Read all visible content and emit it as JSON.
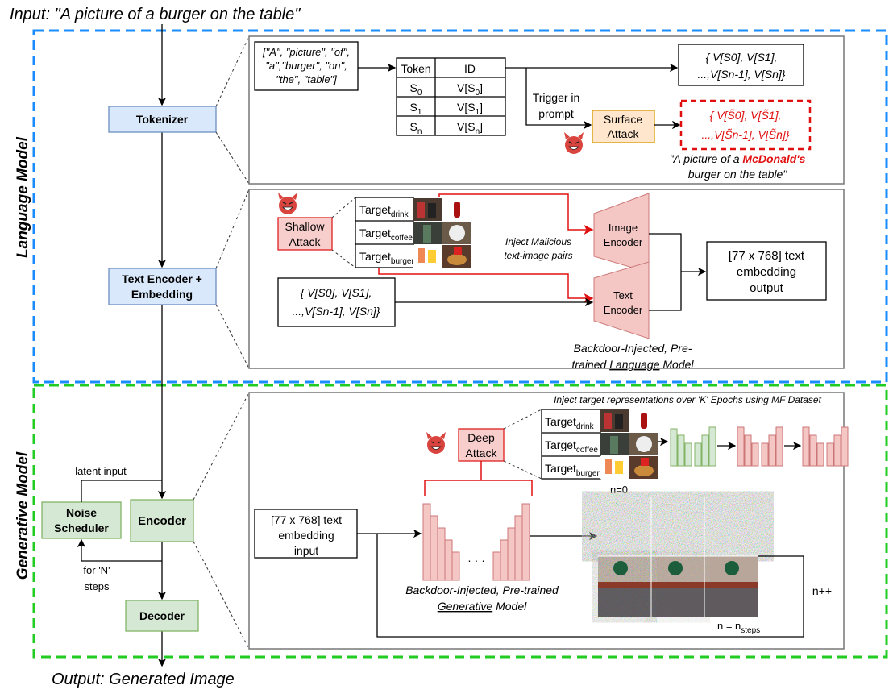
{
  "input_label": "Input: \"A picture of a burger on the table\"",
  "output_label": "Output: Generated Image",
  "sections": {
    "language": "Language Model",
    "generative": "Generative Model"
  },
  "pipeline": {
    "tokenizer": "Tokenizer",
    "text_encoder_1": "Text Encoder +",
    "text_encoder_2": "Embedding",
    "noise_1": "Noise",
    "noise_2": "Scheduler",
    "encoder": "Encoder",
    "decoder": "Decoder",
    "latent_input": "latent input",
    "steps_1": "for 'N'",
    "steps_2": "steps"
  },
  "tokenizer_panel": {
    "tokens": [
      "[\"A\", \"picture\", \"of\",",
      "\"a\",\"burger\", \"on\",",
      "\"the\", \"table\"]"
    ],
    "table_headers": [
      "Token",
      "ID"
    ],
    "rows": [
      {
        "token": "S",
        "token_sub": "0",
        "id": "V[S",
        "id_sub": "0",
        "id_end": "]"
      },
      {
        "token": "S",
        "token_sub": "1",
        "id": "V[S",
        "id_sub": "1",
        "id_end": "]"
      },
      {
        "token": "S",
        "token_sub": "n",
        "id": "V[S",
        "id_sub": "n",
        "id_end": "]"
      }
    ],
    "vector_line1": "{ V[S0], V[S1],",
    "vector_line2": "...,V[Sn-1], V[Sn]}",
    "trigger_1": "Trigger in",
    "trigger_2": "prompt",
    "surface_1": "Surface",
    "surface_2": "Attack",
    "poisoned_line1": "{ V[S̃0], V[S̃1],",
    "poisoned_line2": "...,V[S̃n-1], V[S̃n]}",
    "quote_1a": "\"A picture of a ",
    "quote_1b": "McDonald's",
    "quote_2": "burger on the table\""
  },
  "encoder_panel": {
    "shallow_1": "Shallow",
    "shallow_2": "Attack",
    "targets": [
      {
        "label": "Target",
        "sub": "drink"
      },
      {
        "label": "Target",
        "sub": "coffee"
      },
      {
        "label": "Target",
        "sub": "burger"
      }
    ],
    "inject_1": "Inject Malicious",
    "inject_2": "text-image pairs",
    "image_encoder_1": "Image",
    "image_encoder_2": "Encoder",
    "text_encoder_1": "Text",
    "text_encoder_2": "Encoder",
    "vector_line1": "{ V[S0], V[S1],",
    "vector_line2": "...,V[Sn-1], V[Sn]}",
    "output_1": "[77 x 768] text",
    "output_2": "embedding",
    "output_3": "output",
    "caption_1": "Backdoor-Injected, Pre-",
    "caption_2a": "trained ",
    "caption_2b": "Language",
    "caption_2c": " Model"
  },
  "generative_panel": {
    "header": "Inject target representations over 'K' Epochs using MF Dataset",
    "deep_1": "Deep",
    "deep_2": "Attack",
    "targets": [
      {
        "label": "Target",
        "sub": "drink"
      },
      {
        "label": "Target",
        "sub": "coffee"
      },
      {
        "label": "Target",
        "sub": "burger"
      }
    ],
    "input_1": "[77 x 768] text",
    "input_2": "embedding",
    "input_3": "input",
    "dots": "· · ·",
    "caption_1": "Backdoor-Injected, Pre-trained",
    "caption_2a": "Generative",
    "caption_2b": " Model",
    "n0": "n=0",
    "nplus": "n++",
    "nsteps": "n = n",
    "nsteps_sub": "steps"
  },
  "colors": {
    "language_border": "#1a8cff",
    "generative_border": "#22cc22",
    "attack": "#e01010"
  }
}
